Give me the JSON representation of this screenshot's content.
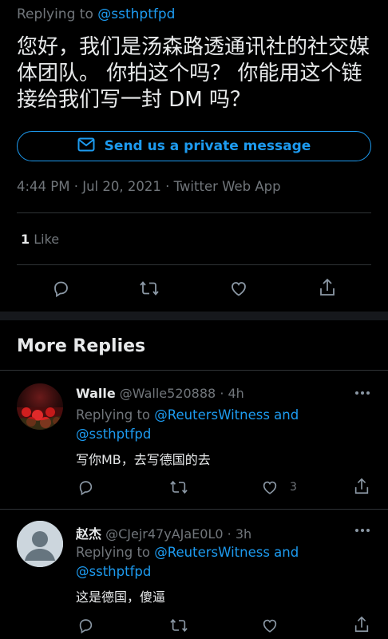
{
  "tweet": {
    "replying_prefix": "Replying to ",
    "replying_handle": "@ssthptfpd",
    "text": "您好，我们是汤森路透通讯社的社交媒体团队。 你拍这个吗？ 你能用这个链接给我们写一封 DM 吗？",
    "dm_button_label": "Send us a private message",
    "timestamp": "4:44 PM · Jul 20, 2021 · Twitter Web App",
    "likes_count": "1",
    "likes_label": " Like"
  },
  "more_replies": {
    "title": "More Replies",
    "replies": [
      {
        "name": "Walle",
        "handle": "@Walle520888",
        "time": "· 4h",
        "replying_prefix": "Replying to ",
        "replying_to": "@ReutersWitness and @ssthptfpd",
        "text": "写你MB，去写德国的去",
        "like_count": "3"
      },
      {
        "name": "赵杰",
        "handle": "@CJejr47yAJaE0L0",
        "time": "· 3h",
        "replying_prefix": "Replying to ",
        "replying_to": "@ReutersWitness and @ssthptfpd",
        "text": "这是德国，傻逼",
        "like_count": ""
      }
    ]
  },
  "colors": {
    "background": "#000000",
    "accent": "#1d9bf0",
    "muted": "#71767b",
    "divider": "#2f3336"
  },
  "icons": [
    "mail-icon",
    "reply-icon",
    "retweet-icon",
    "like-icon",
    "share-icon",
    "more-icon",
    "default-avatar-icon"
  ]
}
